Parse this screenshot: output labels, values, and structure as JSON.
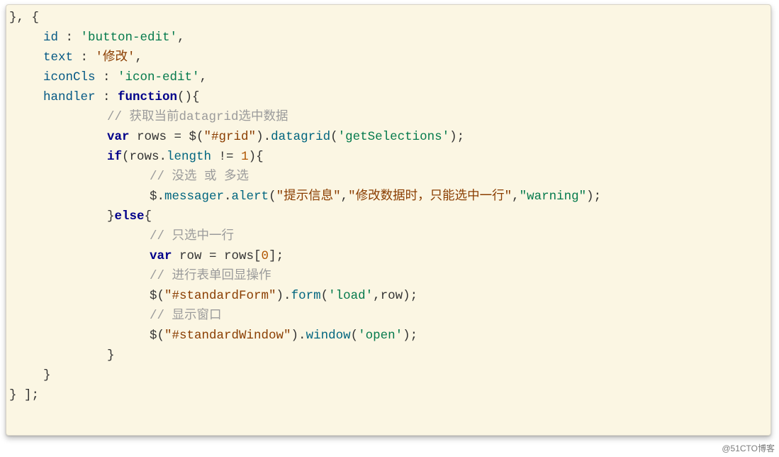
{
  "code": {
    "lines": [
      {
        "indent": "ind0",
        "tokens": [
          {
            "cls": "tok-punct",
            "t": "}, {"
          }
        ]
      },
      {
        "indent": "ind1",
        "tokens": [
          {
            "cls": "tok-prop",
            "t": "id"
          },
          {
            "cls": "tok-punct",
            "t": " : "
          },
          {
            "cls": "tok-str-g",
            "t": "'button-edit'"
          },
          {
            "cls": "tok-punct",
            "t": ","
          }
        ]
      },
      {
        "indent": "ind1",
        "tokens": [
          {
            "cls": "tok-prop",
            "t": "text"
          },
          {
            "cls": "tok-punct",
            "t": " : "
          },
          {
            "cls": "tok-str-b",
            "t": "'修改'"
          },
          {
            "cls": "tok-punct",
            "t": ","
          }
        ]
      },
      {
        "indent": "ind1",
        "tokens": [
          {
            "cls": "tok-prop",
            "t": "iconCls"
          },
          {
            "cls": "tok-punct",
            "t": " : "
          },
          {
            "cls": "tok-str-g",
            "t": "'icon-edit'"
          },
          {
            "cls": "tok-punct",
            "t": ","
          }
        ]
      },
      {
        "indent": "ind1",
        "tokens": [
          {
            "cls": "tok-prop",
            "t": "handler"
          },
          {
            "cls": "tok-punct",
            "t": " : "
          },
          {
            "cls": "tok-kw",
            "t": "function"
          },
          {
            "cls": "tok-punct",
            "t": "(){"
          }
        ]
      },
      {
        "indent": "ind2",
        "tokens": [
          {
            "cls": "tok-comment",
            "t": "// 获取当前datagrid选中数据"
          }
        ]
      },
      {
        "indent": "ind2",
        "tokens": [
          {
            "cls": "tok-kw",
            "t": "var"
          },
          {
            "cls": "tok-default",
            "t": " rows = $("
          },
          {
            "cls": "tok-str-b",
            "t": "\"#grid\""
          },
          {
            "cls": "tok-default",
            "t": ")."
          },
          {
            "cls": "tok-method",
            "t": "datagrid"
          },
          {
            "cls": "tok-default",
            "t": "("
          },
          {
            "cls": "tok-str-g",
            "t": "'getSelections'"
          },
          {
            "cls": "tok-default",
            "t": ");"
          }
        ]
      },
      {
        "indent": "ind2",
        "tokens": [
          {
            "cls": "tok-kw",
            "t": "if"
          },
          {
            "cls": "tok-default",
            "t": "(rows."
          },
          {
            "cls": "tok-method",
            "t": "length"
          },
          {
            "cls": "tok-default",
            "t": " != "
          },
          {
            "cls": "tok-num",
            "t": "1"
          },
          {
            "cls": "tok-default",
            "t": "){"
          }
        ]
      },
      {
        "indent": "ind3",
        "tokens": [
          {
            "cls": "tok-comment",
            "t": "// 没选 或 多选"
          }
        ]
      },
      {
        "indent": "ind3",
        "tokens": [
          {
            "cls": "tok-default",
            "t": "$."
          },
          {
            "cls": "tok-method",
            "t": "messager"
          },
          {
            "cls": "tok-default",
            "t": "."
          },
          {
            "cls": "tok-method",
            "t": "alert"
          },
          {
            "cls": "tok-default",
            "t": "("
          },
          {
            "cls": "tok-str-b",
            "t": "\"提示信息\""
          },
          {
            "cls": "tok-default",
            "t": ","
          },
          {
            "cls": "tok-str-b",
            "t": "\"修改数据时，只能选中一行\""
          },
          {
            "cls": "tok-default",
            "t": ","
          },
          {
            "cls": "tok-str-g",
            "t": "\"warning\""
          },
          {
            "cls": "tok-default",
            "t": ");"
          }
        ]
      },
      {
        "indent": "ind2",
        "tokens": [
          {
            "cls": "tok-default",
            "t": "}"
          },
          {
            "cls": "tok-kw",
            "t": "else"
          },
          {
            "cls": "tok-default",
            "t": "{"
          }
        ]
      },
      {
        "indent": "ind3",
        "tokens": [
          {
            "cls": "tok-comment",
            "t": "// 只选中一行"
          }
        ]
      },
      {
        "indent": "ind3",
        "tokens": [
          {
            "cls": "tok-kw",
            "t": "var"
          },
          {
            "cls": "tok-default",
            "t": " row = rows["
          },
          {
            "cls": "tok-num",
            "t": "0"
          },
          {
            "cls": "tok-default",
            "t": "];"
          }
        ]
      },
      {
        "indent": "ind3",
        "tokens": [
          {
            "cls": "tok-comment",
            "t": "// 进行表单回显操作"
          }
        ]
      },
      {
        "indent": "ind3",
        "tokens": [
          {
            "cls": "tok-default",
            "t": "$("
          },
          {
            "cls": "tok-str-b",
            "t": "\"#standardForm\""
          },
          {
            "cls": "tok-default",
            "t": ")."
          },
          {
            "cls": "tok-method",
            "t": "form"
          },
          {
            "cls": "tok-default",
            "t": "("
          },
          {
            "cls": "tok-str-g",
            "t": "'load'"
          },
          {
            "cls": "tok-default",
            "t": ",row);"
          }
        ]
      },
      {
        "indent": "ind3",
        "tokens": [
          {
            "cls": "tok-comment",
            "t": "// 显示窗口"
          }
        ]
      },
      {
        "indent": "ind3",
        "tokens": [
          {
            "cls": "tok-default",
            "t": "$("
          },
          {
            "cls": "tok-str-b",
            "t": "\"#standardWindow\""
          },
          {
            "cls": "tok-default",
            "t": ")."
          },
          {
            "cls": "tok-method",
            "t": "window"
          },
          {
            "cls": "tok-default",
            "t": "("
          },
          {
            "cls": "tok-str-g",
            "t": "'open'"
          },
          {
            "cls": "tok-default",
            "t": ");"
          }
        ]
      },
      {
        "indent": "ind2",
        "tokens": [
          {
            "cls": "tok-default",
            "t": "}"
          }
        ]
      },
      {
        "indent": "ind1",
        "tokens": [
          {
            "cls": "tok-default",
            "t": "}"
          }
        ]
      },
      {
        "indent": "ind0",
        "tokens": [
          {
            "cls": "tok-default",
            "t": "} ];"
          }
        ]
      }
    ]
  },
  "watermark": "@51CTO博客"
}
